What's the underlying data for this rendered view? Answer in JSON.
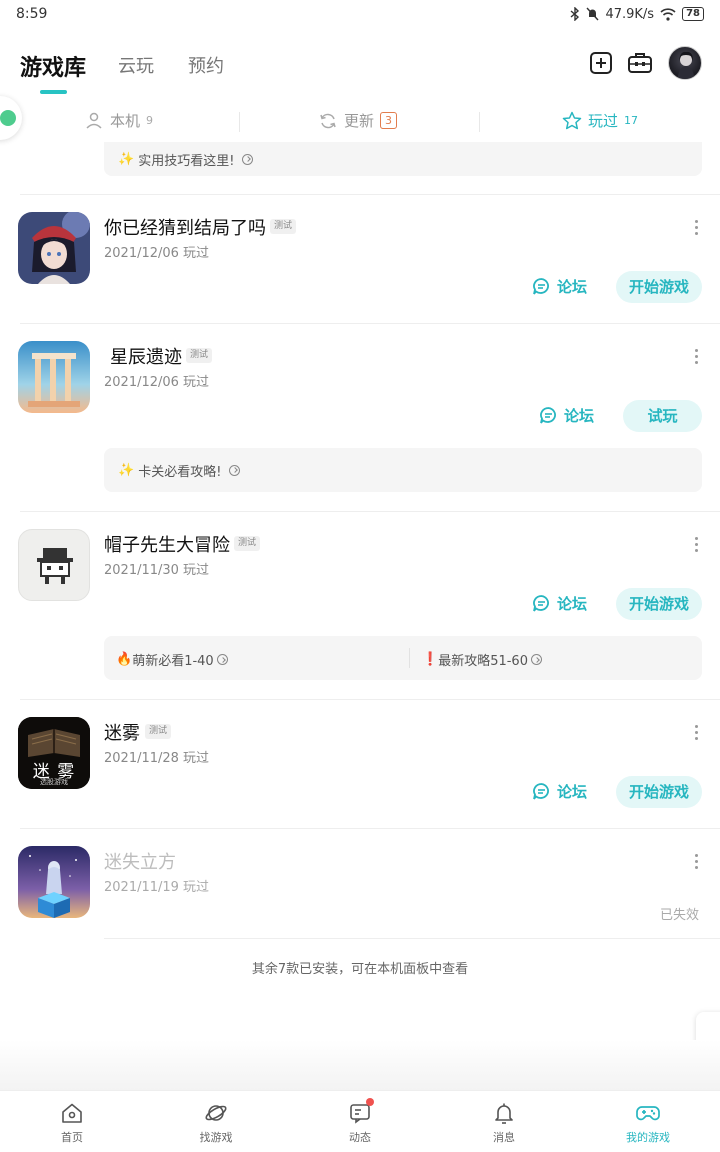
{
  "status_bar": {
    "time": "8:59",
    "net_speed": "47.9K/s",
    "battery": "78"
  },
  "header": {
    "tabs": [
      {
        "label": "游戏库",
        "active": true
      },
      {
        "label": "云玩",
        "active": false
      },
      {
        "label": "预约",
        "active": false
      }
    ],
    "icons": [
      "add-icon",
      "toolbox-icon"
    ]
  },
  "filters": {
    "local": {
      "label": "本机",
      "count": "9"
    },
    "update": {
      "label": "更新",
      "count": "3"
    },
    "played": {
      "label": "玩过",
      "count": "17",
      "active": true
    }
  },
  "tips": {
    "top": "实用技巧看这里!",
    "xingchen": "卡关必看攻略!",
    "maozi_left": "萌新必看1-40",
    "maozi_right": "最新攻略51-60"
  },
  "games": [
    {
      "title": "你已经猜到结局了吗",
      "tag": "测试",
      "date": "2021/12/06 玩过",
      "forum": "论坛",
      "action": "开始游戏"
    },
    {
      "title": "星辰遗迹",
      "tag": "测试",
      "date": "2021/12/06 玩过",
      "forum": "论坛",
      "action": "试玩"
    },
    {
      "title": "帽子先生大冒险",
      "tag": "测试",
      "date": "2021/11/30 玩过",
      "forum": "论坛",
      "action": "开始游戏"
    },
    {
      "title": "迷雾",
      "tag": "测试",
      "date": "2021/11/28 玩过",
      "forum": "论坛",
      "action": "开始游戏",
      "icon_text": "迷 雾",
      "icon_subtext": "选股游戏"
    },
    {
      "title": "迷失立方",
      "date": "2021/11/19 玩过",
      "status": "已失效"
    }
  ],
  "footnote": "其余7款已安装，可在本机面板中查看",
  "bottom_nav": [
    {
      "label": "首页",
      "icon": "home-icon"
    },
    {
      "label": "找游戏",
      "icon": "planet-icon"
    },
    {
      "label": "动态",
      "icon": "feed-icon"
    },
    {
      "label": "消息",
      "icon": "bell-icon"
    },
    {
      "label": "我的游戏",
      "icon": "gamepad-icon",
      "active": true
    }
  ],
  "colors": {
    "accent": "#27b6c0",
    "badge": "#e27d4e",
    "notify": "#f0524f"
  }
}
